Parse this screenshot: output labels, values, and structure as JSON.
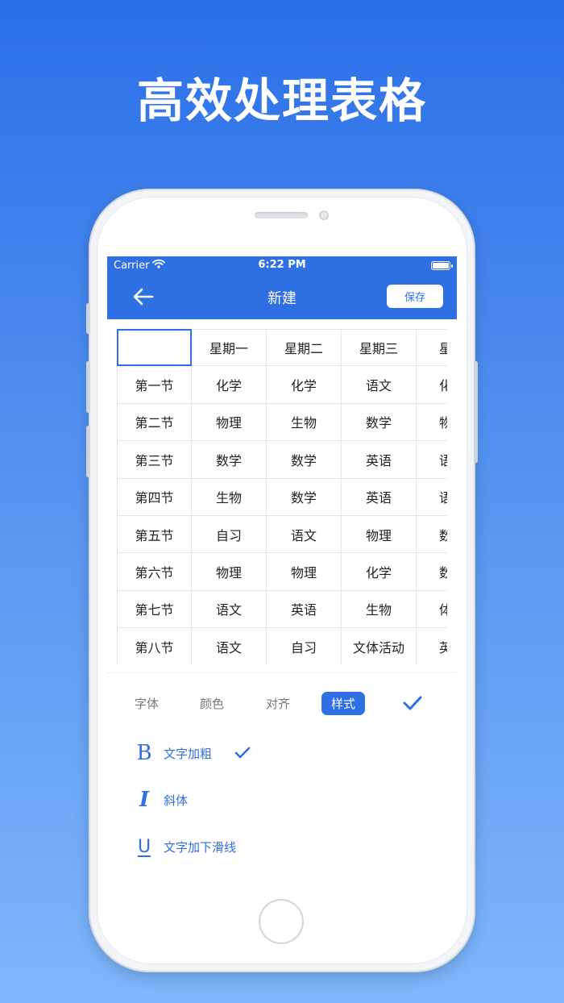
{
  "promo": {
    "title": "高效处理表格"
  },
  "status_bar": {
    "carrier": "Carrier",
    "time": "6:22 PM"
  },
  "nav": {
    "title": "新建",
    "save_label": "保存"
  },
  "table": {
    "header": [
      "",
      "星期一",
      "星期二",
      "星期三",
      "星期"
    ],
    "rows": [
      [
        "第一节",
        "化学",
        "化学",
        "语文",
        "化"
      ],
      [
        "第二节",
        "物理",
        "生物",
        "数学",
        "物"
      ],
      [
        "第三节",
        "数学",
        "数学",
        "英语",
        "语"
      ],
      [
        "第四节",
        "生物",
        "数学",
        "英语",
        "语"
      ],
      [
        "第五节",
        "自习",
        "语文",
        "物理",
        "数"
      ],
      [
        "第六节",
        "物理",
        "物理",
        "化学",
        "数"
      ],
      [
        "第七节",
        "语文",
        "英语",
        "生物",
        "体"
      ],
      [
        "第八节",
        "语文",
        "自习",
        "文体活动",
        "英"
      ]
    ]
  },
  "toolbar": {
    "tabs": [
      {
        "label": "字体"
      },
      {
        "label": "颜色"
      },
      {
        "label": "对齐"
      },
      {
        "label": "样式"
      }
    ],
    "active_tab": "样式"
  },
  "style_options": {
    "bold": {
      "icon_glyph": "B",
      "label": "文字加粗",
      "checked": true
    },
    "italic": {
      "icon_glyph": "I",
      "label": "斜体",
      "checked": false
    },
    "underline": {
      "icon_glyph": "U",
      "label": "文字加下滑线",
      "checked": false
    }
  },
  "colors": {
    "accent": "#2f6fe4",
    "background_top": "#2b6fe8",
    "background_bottom": "#7fb7fb"
  }
}
